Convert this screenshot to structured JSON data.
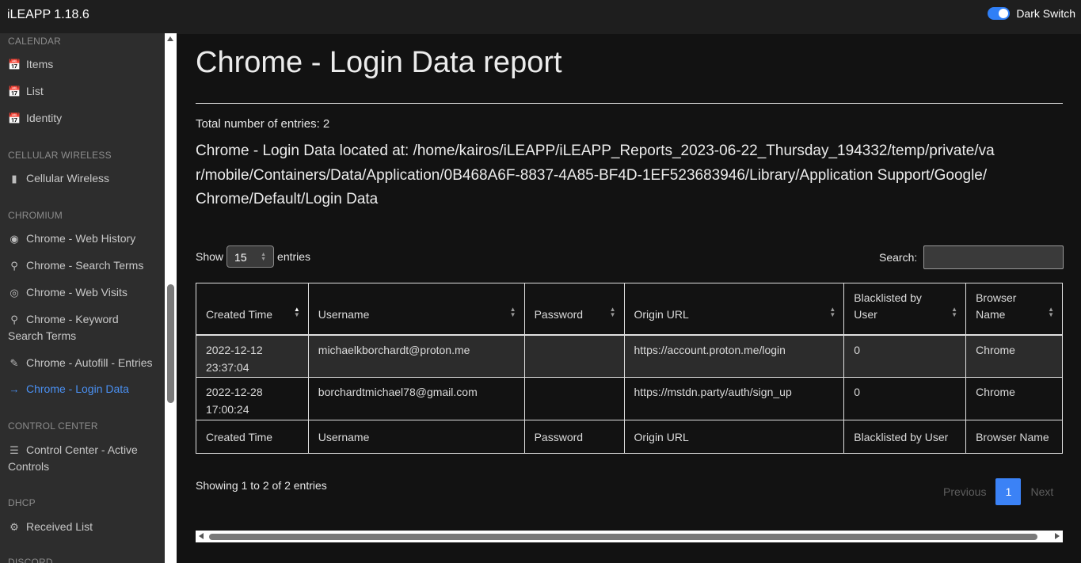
{
  "app": {
    "title": "iLEAPP 1.18.6",
    "dark_switch_label": "Dark Switch",
    "dark_switch_on": true
  },
  "sidebar": {
    "sections": [
      {
        "heading": "CALENDAR",
        "items": [
          {
            "label": "Items",
            "icon": "calendar-icon"
          },
          {
            "label": "List",
            "icon": "calendar-icon"
          },
          {
            "label": "Identity",
            "icon": "calendar-icon"
          }
        ]
      },
      {
        "heading": "CELLULAR WIRELESS",
        "items": [
          {
            "label": "Cellular Wireless",
            "icon": "bar-chart-icon"
          }
        ]
      },
      {
        "heading": "CHROMIUM",
        "items": [
          {
            "label": "Chrome - Web History",
            "icon": "chrome-icon"
          },
          {
            "label": "Chrome - Search Terms",
            "icon": "search-icon"
          },
          {
            "label": "Chrome - Web Visits",
            "icon": "globe-icon"
          },
          {
            "label_line1": "Chrome - Keyword",
            "label_line2": "Search Terms",
            "icon": "search-icon"
          },
          {
            "label": "Chrome - Autofill - Entries",
            "icon": "edit-icon"
          },
          {
            "label": "Chrome - Login Data",
            "icon": "log-in-icon",
            "active": true
          }
        ]
      },
      {
        "heading": "CONTROL CENTER",
        "items": [
          {
            "label_line1": "Control Center - Active",
            "label_line2": "Controls",
            "icon": "sliders-icon"
          }
        ]
      },
      {
        "heading": "DHCP",
        "items": [
          {
            "label": "Received List",
            "icon": "settings-icon"
          }
        ]
      },
      {
        "heading": "DISCORD",
        "items": []
      }
    ]
  },
  "report": {
    "title": "Chrome - Login Data report",
    "total_entries": "Total number of entries: 2",
    "located_at": "Chrome - Login Data located at: /home/kairos/iLEAPP/iLEAPP_Reports_2023-06-22_Thursday_194332/temp/private/var/mobile/Containers/Data/Application/0B468A6F-8837-4A85-BF4D-1EF523683946/Library/Application Support/Google/Chrome/Default/Login Data"
  },
  "table_controls": {
    "show_label": "Show",
    "page_size": "15",
    "entries_label": "entries",
    "search_label": "Search:",
    "search_value": ""
  },
  "table": {
    "columns": [
      "Created Time",
      "Username",
      "Password",
      "Origin URL",
      "Blacklisted by User",
      "Browser Name"
    ],
    "rows": [
      {
        "created_date": "2022-12-12",
        "created_time": "23:37:04",
        "username": "michaelkborchardt@proton.me",
        "password": "",
        "origin_url": "https://account.proton.me/login",
        "blacklisted": "0",
        "browser": "Chrome"
      },
      {
        "created_date": "2022-12-28",
        "created_time": "17:00:24",
        "username": "borchardtmichael78@gmail.com",
        "password": "",
        "origin_url": "https://mstdn.party/auth/sign_up",
        "blacklisted": "0",
        "browser": "Chrome"
      }
    ]
  },
  "pagination": {
    "info": "Showing 1 to 2 of 2 entries",
    "previous": "Previous",
    "current": "1",
    "next": "Next"
  },
  "colors": {
    "accent": "#3b82f6",
    "active_nav": "#4a90f2",
    "background": "#121212",
    "sidebar": "#2d2d2d"
  }
}
